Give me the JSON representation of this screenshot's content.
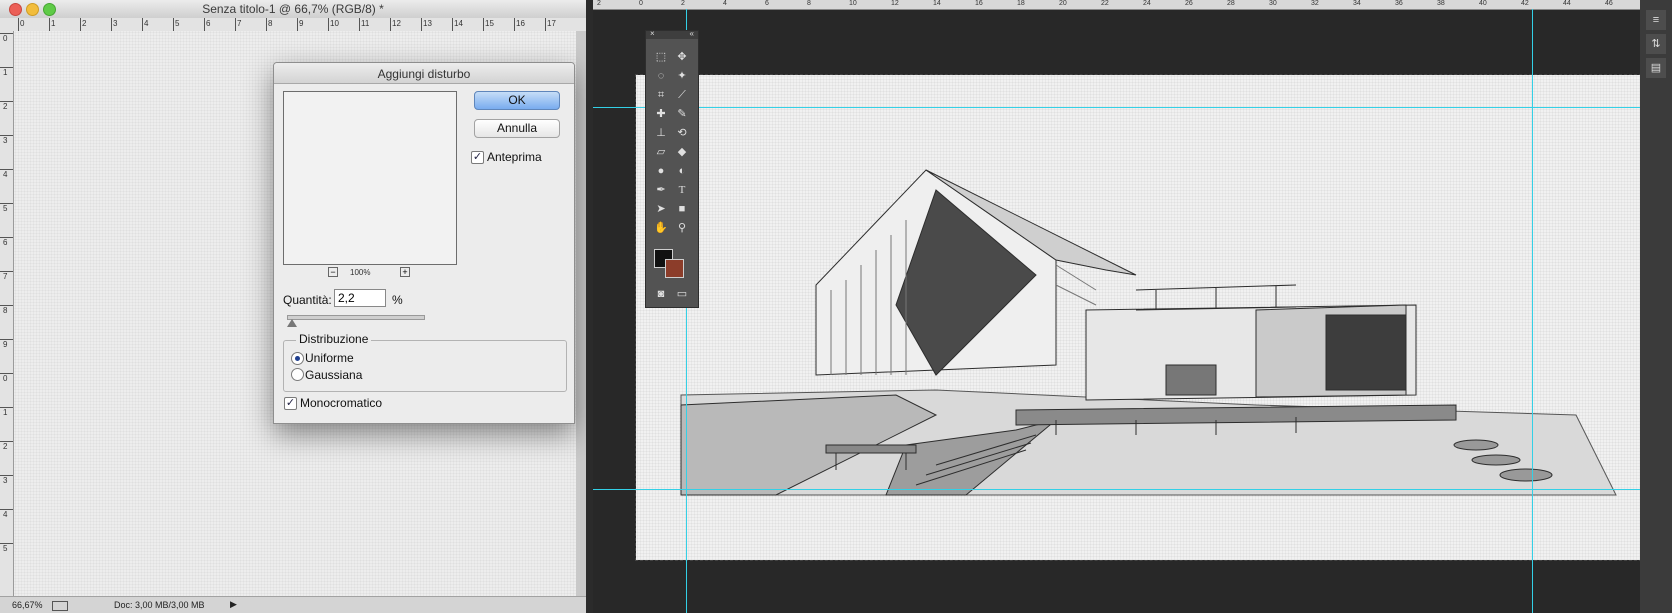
{
  "window": {
    "title": "Senza titolo-1 @ 66,7% (RGB/8) *",
    "ruler_top_numbers": [
      "0",
      "1",
      "2",
      "3",
      "4",
      "5",
      "6",
      "7",
      "8",
      "9",
      "10",
      "11",
      "12",
      "13",
      "14",
      "15",
      "16",
      "17"
    ],
    "ruler_left_numbers": [
      "0",
      "1",
      "2",
      "3",
      "4",
      "5",
      "6",
      "7",
      "8",
      "9",
      "0",
      "1",
      "2",
      "3",
      "4",
      "5"
    ]
  },
  "status_bar": {
    "zoom": "66,67%",
    "doc_info": "Doc: 3,00 MB/3,00 MB",
    "arrow": "▶"
  },
  "dialog": {
    "title": "Aggiungi disturbo",
    "ok_label": "OK",
    "cancel_label": "Annulla",
    "preview_checkbox": {
      "label": "Anteprima",
      "checked": true
    },
    "zoom": {
      "minus": "−",
      "level": "100%",
      "plus": "+"
    },
    "amount": {
      "label": "Quantità:",
      "value": "2,2",
      "unit": "%"
    },
    "slider_level_fraction": 0.01,
    "distribution": {
      "label": "Distribuzione",
      "options": [
        "Uniforme",
        "Gaussiana"
      ],
      "selected": "Uniforme"
    },
    "monochromatic": {
      "label": "Monocromatico",
      "checked": true
    }
  },
  "right_window": {
    "ruler_numbers": [
      "2",
      "0",
      "2",
      "4",
      "6",
      "8",
      "10",
      "12",
      "14",
      "16",
      "18",
      "20",
      "22",
      "24",
      "26",
      "28",
      "30",
      "32",
      "34",
      "36",
      "38",
      "40",
      "42",
      "44",
      "46"
    ]
  },
  "toolbar": {
    "close": "×",
    "collapse": "«",
    "tools": [
      "marquee-icon",
      "move-icon",
      "lasso-icon",
      "magic-wand-icon",
      "crop-icon",
      "eyedropper-icon",
      "healing-icon",
      "brush-icon",
      "stamp-icon",
      "history-brush-icon",
      "eraser-icon",
      "bucket-icon",
      "blur-icon",
      "dodge-icon",
      "pen-icon",
      "type-icon",
      "path-select-icon",
      "shape-icon",
      "hand-icon",
      "zoom-icon"
    ],
    "foreground_color": "#111111",
    "background_color": "#8c3d2a"
  },
  "colors": {
    "guide": "#33d0e6",
    "ok_button": "#79acef"
  }
}
